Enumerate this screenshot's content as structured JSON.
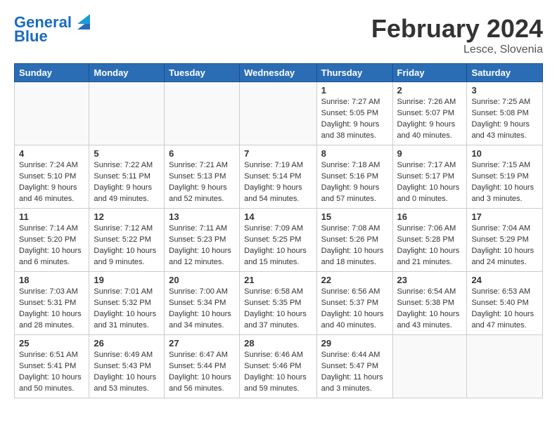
{
  "header": {
    "logo_line1": "General",
    "logo_line2": "Blue",
    "month_title": "February 2024",
    "location": "Lesce, Slovenia"
  },
  "columns": [
    "Sunday",
    "Monday",
    "Tuesday",
    "Wednesday",
    "Thursday",
    "Friday",
    "Saturday"
  ],
  "weeks": [
    [
      {
        "day": "",
        "info": ""
      },
      {
        "day": "",
        "info": ""
      },
      {
        "day": "",
        "info": ""
      },
      {
        "day": "",
        "info": ""
      },
      {
        "day": "1",
        "info": "Sunrise: 7:27 AM\nSunset: 5:05 PM\nDaylight: 9 hours\nand 38 minutes."
      },
      {
        "day": "2",
        "info": "Sunrise: 7:26 AM\nSunset: 5:07 PM\nDaylight: 9 hours\nand 40 minutes."
      },
      {
        "day": "3",
        "info": "Sunrise: 7:25 AM\nSunset: 5:08 PM\nDaylight: 9 hours\nand 43 minutes."
      }
    ],
    [
      {
        "day": "4",
        "info": "Sunrise: 7:24 AM\nSunset: 5:10 PM\nDaylight: 9 hours\nand 46 minutes."
      },
      {
        "day": "5",
        "info": "Sunrise: 7:22 AM\nSunset: 5:11 PM\nDaylight: 9 hours\nand 49 minutes."
      },
      {
        "day": "6",
        "info": "Sunrise: 7:21 AM\nSunset: 5:13 PM\nDaylight: 9 hours\nand 52 minutes."
      },
      {
        "day": "7",
        "info": "Sunrise: 7:19 AM\nSunset: 5:14 PM\nDaylight: 9 hours\nand 54 minutes."
      },
      {
        "day": "8",
        "info": "Sunrise: 7:18 AM\nSunset: 5:16 PM\nDaylight: 9 hours\nand 57 minutes."
      },
      {
        "day": "9",
        "info": "Sunrise: 7:17 AM\nSunset: 5:17 PM\nDaylight: 10 hours\nand 0 minutes."
      },
      {
        "day": "10",
        "info": "Sunrise: 7:15 AM\nSunset: 5:19 PM\nDaylight: 10 hours\nand 3 minutes."
      }
    ],
    [
      {
        "day": "11",
        "info": "Sunrise: 7:14 AM\nSunset: 5:20 PM\nDaylight: 10 hours\nand 6 minutes."
      },
      {
        "day": "12",
        "info": "Sunrise: 7:12 AM\nSunset: 5:22 PM\nDaylight: 10 hours\nand 9 minutes."
      },
      {
        "day": "13",
        "info": "Sunrise: 7:11 AM\nSunset: 5:23 PM\nDaylight: 10 hours\nand 12 minutes."
      },
      {
        "day": "14",
        "info": "Sunrise: 7:09 AM\nSunset: 5:25 PM\nDaylight: 10 hours\nand 15 minutes."
      },
      {
        "day": "15",
        "info": "Sunrise: 7:08 AM\nSunset: 5:26 PM\nDaylight: 10 hours\nand 18 minutes."
      },
      {
        "day": "16",
        "info": "Sunrise: 7:06 AM\nSunset: 5:28 PM\nDaylight: 10 hours\nand 21 minutes."
      },
      {
        "day": "17",
        "info": "Sunrise: 7:04 AM\nSunset: 5:29 PM\nDaylight: 10 hours\nand 24 minutes."
      }
    ],
    [
      {
        "day": "18",
        "info": "Sunrise: 7:03 AM\nSunset: 5:31 PM\nDaylight: 10 hours\nand 28 minutes."
      },
      {
        "day": "19",
        "info": "Sunrise: 7:01 AM\nSunset: 5:32 PM\nDaylight: 10 hours\nand 31 minutes."
      },
      {
        "day": "20",
        "info": "Sunrise: 7:00 AM\nSunset: 5:34 PM\nDaylight: 10 hours\nand 34 minutes."
      },
      {
        "day": "21",
        "info": "Sunrise: 6:58 AM\nSunset: 5:35 PM\nDaylight: 10 hours\nand 37 minutes."
      },
      {
        "day": "22",
        "info": "Sunrise: 6:56 AM\nSunset: 5:37 PM\nDaylight: 10 hours\nand 40 minutes."
      },
      {
        "day": "23",
        "info": "Sunrise: 6:54 AM\nSunset: 5:38 PM\nDaylight: 10 hours\nand 43 minutes."
      },
      {
        "day": "24",
        "info": "Sunrise: 6:53 AM\nSunset: 5:40 PM\nDaylight: 10 hours\nand 47 minutes."
      }
    ],
    [
      {
        "day": "25",
        "info": "Sunrise: 6:51 AM\nSunset: 5:41 PM\nDaylight: 10 hours\nand 50 minutes."
      },
      {
        "day": "26",
        "info": "Sunrise: 6:49 AM\nSunset: 5:43 PM\nDaylight: 10 hours\nand 53 minutes."
      },
      {
        "day": "27",
        "info": "Sunrise: 6:47 AM\nSunset: 5:44 PM\nDaylight: 10 hours\nand 56 minutes."
      },
      {
        "day": "28",
        "info": "Sunrise: 6:46 AM\nSunset: 5:46 PM\nDaylight: 10 hours\nand 59 minutes."
      },
      {
        "day": "29",
        "info": "Sunrise: 6:44 AM\nSunset: 5:47 PM\nDaylight: 11 hours\nand 3 minutes."
      },
      {
        "day": "",
        "info": ""
      },
      {
        "day": "",
        "info": ""
      }
    ]
  ]
}
